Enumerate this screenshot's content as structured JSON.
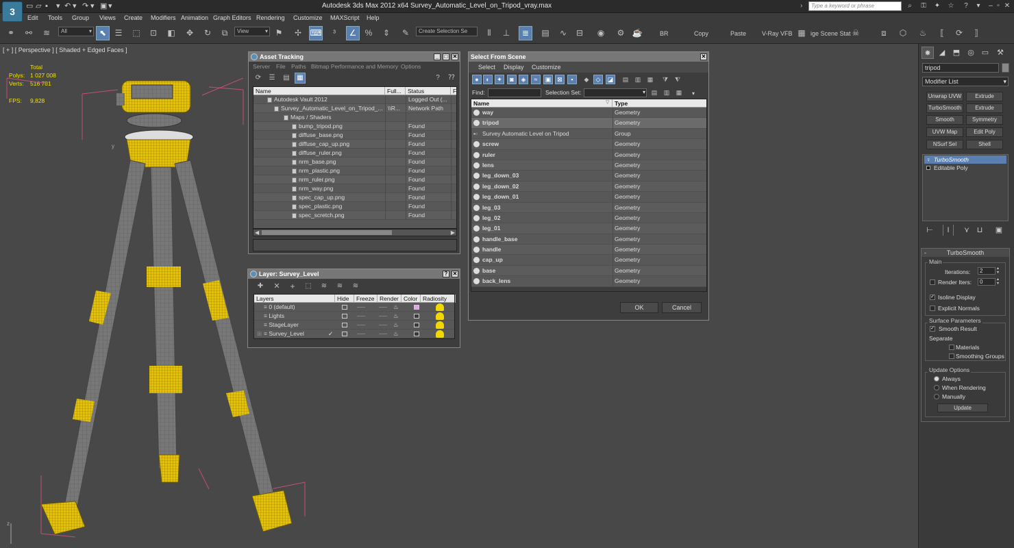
{
  "app": {
    "title": "Autodesk 3ds Max  2012 x64     Survey_Automatic_Level_on_Tripod_vray.max",
    "search_placeholder": "Type a keyword or phrase",
    "logo": "3"
  },
  "menu": [
    "Edit",
    "Tools",
    "Group",
    "Views",
    "Create",
    "Modifiers",
    "Animation",
    "Graph Editors",
    "Rendering",
    "Customize",
    "MAXScript",
    "Help"
  ],
  "toolbar": {
    "filter_value": "All",
    "view_value": "View",
    "selection_set_placeholder": "Create Selection Se",
    "br_label": "BR",
    "copy_label": "Copy",
    "paste_label": "Paste",
    "vray_label": "V-Ray VFB",
    "scene_label": "ige Scene Stat"
  },
  "viewport": {
    "label": "[ + ] [ Perspective ] [ Shaded + Edged Faces ]",
    "stats": {
      "total_label": "Total",
      "polys_label": "Polys:",
      "polys_value": "1 027 008",
      "verts_label": "Verts:",
      "verts_value": "516 781",
      "fps_label": "FPS:",
      "fps_value": "9,828"
    },
    "axis_y": "y",
    "axis_z": "z"
  },
  "asset_tracking": {
    "title": "Asset Tracking",
    "menu": [
      "Server",
      "File",
      "Paths",
      "Bitmap Performance and Memory",
      "Options"
    ],
    "columns": [
      "Name",
      "Full...",
      "Status",
      "F"
    ],
    "rows": [
      {
        "name": "Autodesk Vault 2012",
        "full": "",
        "status": "Logged Out (...",
        "indent": 1
      },
      {
        "name": "Survey_Automatic_Level_on_Tripod_...",
        "full": "\\\\R...",
        "status": "Network Path",
        "indent": 2
      },
      {
        "name": "Maps / Shaders",
        "full": "",
        "status": "",
        "indent": 3
      },
      {
        "name": "bump_tripod.png",
        "full": "",
        "status": "Found",
        "indent": 4
      },
      {
        "name": "diffuse_base.png",
        "full": "",
        "status": "Found",
        "indent": 4
      },
      {
        "name": "diffuse_cap_up.png",
        "full": "",
        "status": "Found",
        "indent": 4
      },
      {
        "name": "diffuse_ruler.png",
        "full": "",
        "status": "Found",
        "indent": 4
      },
      {
        "name": "nrm_base.png",
        "full": "",
        "status": "Found",
        "indent": 4
      },
      {
        "name": "nrm_plastic.png",
        "full": "",
        "status": "Found",
        "indent": 4
      },
      {
        "name": "nrm_ruler.png",
        "full": "",
        "status": "Found",
        "indent": 4
      },
      {
        "name": "nrm_way.png",
        "full": "",
        "status": "Found",
        "indent": 4
      },
      {
        "name": "spec_cap_up.png",
        "full": "",
        "status": "Found",
        "indent": 4
      },
      {
        "name": "spec_plastic.png",
        "full": "",
        "status": "Found",
        "indent": 4
      },
      {
        "name": "spec_scretch.png",
        "full": "",
        "status": "Found",
        "indent": 4
      }
    ]
  },
  "layer": {
    "title": "Layer: Survey_Level",
    "columns": [
      "Layers",
      "Hide",
      "Freeze",
      "Render",
      "Color",
      "Radiosity"
    ],
    "rows": [
      {
        "name": "0 (default)",
        "color": "#e8a0e8",
        "current": false
      },
      {
        "name": "Lights",
        "color": "#3a3a3a",
        "current": false
      },
      {
        "name": "StageLayer",
        "color": "#3a3a3a",
        "current": false
      },
      {
        "name": "Survey_Level",
        "color": "#3a3a3a",
        "current": true
      }
    ]
  },
  "select_scene": {
    "title": "Select From Scene",
    "menu": [
      "Select",
      "Display",
      "Customize"
    ],
    "find_label": "Find:",
    "selset_label": "Selection Set:",
    "columns": [
      "Name",
      "Type"
    ],
    "rows": [
      {
        "name": "way",
        "type": "Geometry",
        "bold": true,
        "sel": false
      },
      {
        "name": "tripod",
        "type": "Geometry",
        "bold": true,
        "sel": true
      },
      {
        "name": "Survey Automatic Level on Tripod",
        "type": "Group",
        "bold": false,
        "sel": false
      },
      {
        "name": "screw",
        "type": "Geometry",
        "bold": true,
        "sel": false
      },
      {
        "name": "ruler",
        "type": "Geometry",
        "bold": true,
        "sel": false
      },
      {
        "name": "lens",
        "type": "Geometry",
        "bold": true,
        "sel": false
      },
      {
        "name": "leg_down_03",
        "type": "Geometry",
        "bold": true,
        "sel": false
      },
      {
        "name": "leg_down_02",
        "type": "Geometry",
        "bold": true,
        "sel": false
      },
      {
        "name": "leg_down_01",
        "type": "Geometry",
        "bold": true,
        "sel": false
      },
      {
        "name": "leg_03",
        "type": "Geometry",
        "bold": true,
        "sel": false
      },
      {
        "name": "leg_02",
        "type": "Geometry",
        "bold": true,
        "sel": false
      },
      {
        "name": "leg_01",
        "type": "Geometry",
        "bold": true,
        "sel": false
      },
      {
        "name": "handle_base",
        "type": "Geometry",
        "bold": true,
        "sel": false
      },
      {
        "name": "handle",
        "type": "Geometry",
        "bold": true,
        "sel": false
      },
      {
        "name": "cap_up",
        "type": "Geometry",
        "bold": true,
        "sel": false
      },
      {
        "name": "base",
        "type": "Geometry",
        "bold": true,
        "sel": false
      },
      {
        "name": "back_lens",
        "type": "Geometry",
        "bold": true,
        "sel": false
      }
    ],
    "ok_label": "OK",
    "cancel_label": "Cancel"
  },
  "cmdpanel": {
    "object_name": "tripod",
    "modifier_list": "Modifier List",
    "buttons": [
      "Unwrap UVW",
      "Extrude",
      "TurboSmooth",
      "Extrude",
      "Smooth",
      "Symmetry",
      "UVW Map",
      "Edit Poly",
      "NSurf Sel",
      "Shell"
    ],
    "stack": [
      "TurboSmooth",
      "Editable Poly"
    ],
    "turbosmooth": {
      "title": "TurboSmooth",
      "main_label": "Main",
      "iterations_label": "Iterations:",
      "iterations_value": "2",
      "render_iters_label": "Render Iters:",
      "render_iters_value": "0",
      "isoline_label": "Isoline Display",
      "explicit_label": "Explicit Normals",
      "surface_label": "Surface Parameters",
      "smooth_result_label": "Smooth Result",
      "separate_label": "Separate",
      "materials_label": "Materials",
      "smoothing_groups_label": "Smoothing Groups",
      "update_label": "Update Options",
      "always_label": "Always",
      "when_rendering_label": "When Rendering",
      "manually_label": "Manually",
      "update_btn": "Update"
    }
  },
  "colors": {
    "accent": "#5a7fb0",
    "mesh_yellow": "#e6c200",
    "mesh_gray": "#7a7a7a",
    "stat_yellow": "#f2e300"
  }
}
